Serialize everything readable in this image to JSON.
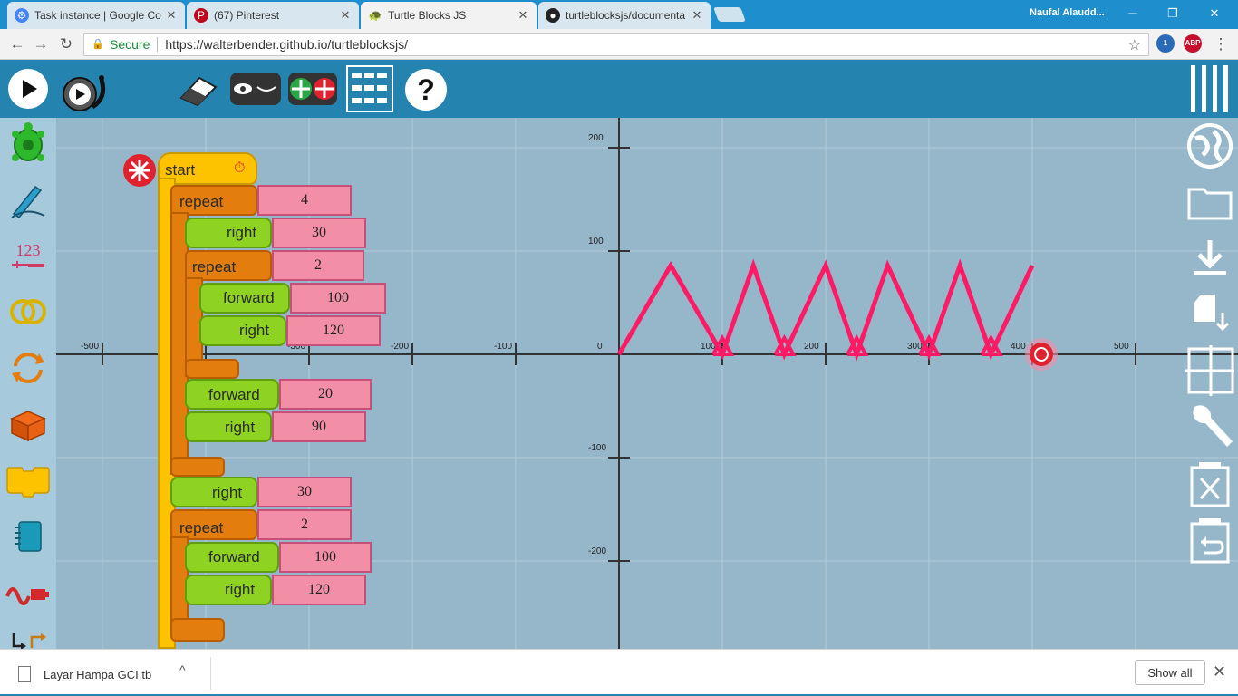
{
  "browser": {
    "tabs": [
      {
        "label": "Task instance | Google Co",
        "icon": "gear-icon",
        "color": "#4285f4"
      },
      {
        "label": "(67) Pinterest",
        "icon": "pinterest-icon",
        "color": "#bd081c"
      },
      {
        "label": "Turtle Blocks JS",
        "icon": "turtle-icon",
        "color": "#2e7d32"
      },
      {
        "label": "turtleblocksjs/documenta",
        "icon": "github-icon",
        "color": "#222222"
      }
    ],
    "profile": "Naufal Alaudd...",
    "address": {
      "secure_label": "Secure",
      "url": "https://walterbender.github.io/turtleblocksjs/"
    },
    "extensions": [
      "profile-extension-icon",
      "adblock-icon"
    ],
    "ext_abp": "ABP",
    "ext_badge": "1"
  },
  "toolbar": {
    "buttons": [
      "play-icon",
      "slow-run-icon",
      "eraser-icon",
      "hide-blocks-icon",
      "collapse-blocks-icon",
      "grid-icon",
      "help-icon",
      "menu-icon"
    ]
  },
  "palette": {
    "items": [
      "turtle-icon",
      "pen-icon",
      "number-icon",
      "boolean-icon",
      "flow-icon",
      "box-icon",
      "action-icon",
      "media-icon",
      "sensors-icon",
      "extras-icon"
    ],
    "number_label": "123"
  },
  "right_tools": [
    "globe-icon",
    "open-folder-icon",
    "save-icon",
    "save-as-icon",
    "grid-coordinates-icon",
    "settings-icon",
    "clear-icon",
    "restore-trash-icon"
  ],
  "blocks": {
    "start": {
      "label": "start"
    },
    "repeat1": {
      "label": "repeat",
      "value": "4"
    },
    "right1": {
      "label": "right",
      "value": "30"
    },
    "repeat2": {
      "label": "repeat",
      "value": "2"
    },
    "forward1": {
      "label": "forward",
      "value": "100"
    },
    "right2": {
      "label": "right",
      "value": "120"
    },
    "forward2": {
      "label": "forward",
      "value": "20"
    },
    "right3": {
      "label": "right",
      "value": "90"
    },
    "right4": {
      "label": "right",
      "value": "30"
    },
    "repeat3": {
      "label": "repeat",
      "value": "2"
    },
    "forward3": {
      "label": "forward",
      "value": "100"
    },
    "right5": {
      "label": "right",
      "value": "120"
    }
  },
  "chart_data": {
    "type": "line",
    "x_ticks": [
      "-500",
      "-400",
      "-300",
      "-200",
      "-100",
      "0",
      "100",
      "200",
      "300",
      "400",
      "500"
    ],
    "y_ticks": [
      "200",
      "100",
      "-100",
      "-200"
    ],
    "series": [
      {
        "color": "#ff1a66",
        "x": [
          0,
          50,
          100,
          130,
          160,
          200,
          230,
          260,
          300,
          330,
          360,
          400
        ],
        "y": [
          0,
          86,
          0,
          86,
          0,
          86,
          0,
          86,
          0,
          86,
          0,
          86
        ]
      }
    ],
    "xlim": [
      -500,
      500
    ],
    "ylim": [
      -200,
      200
    ],
    "grid": true
  },
  "download_bar": {
    "filename": "Layar Hampa GCI.tb",
    "show_all": "Show all"
  }
}
